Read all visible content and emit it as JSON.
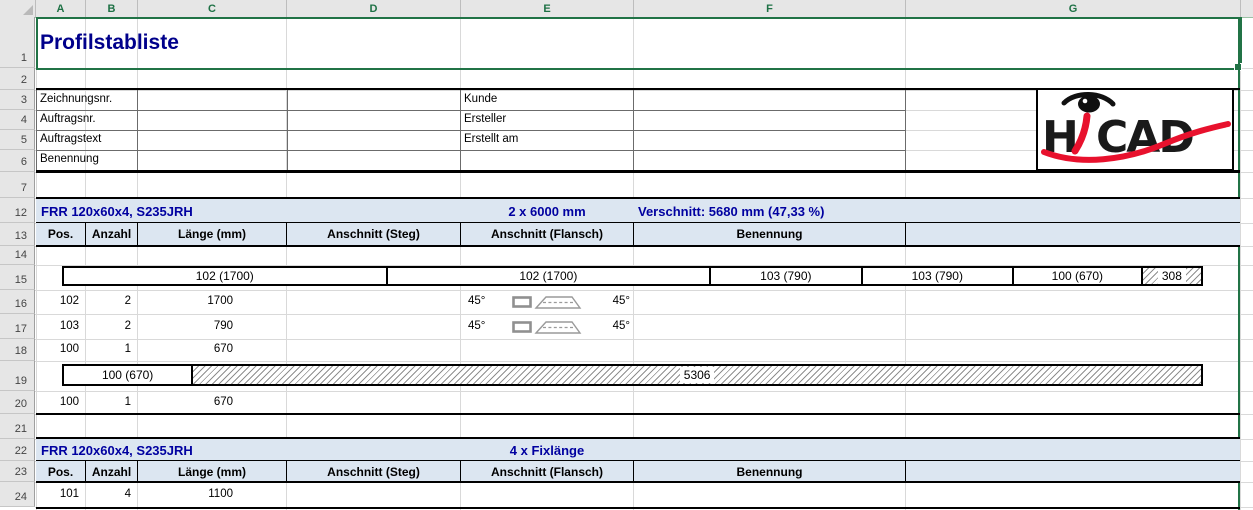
{
  "colors": {
    "accent_green": "#217346",
    "band_blue_bg": "#dce6f1",
    "navy_text": "#0000A0",
    "logo_red": "#E8112D"
  },
  "sheet": {
    "columns": [
      {
        "label": "A"
      },
      {
        "label": "B"
      },
      {
        "label": "C"
      },
      {
        "label": "D"
      },
      {
        "label": "E"
      },
      {
        "label": "F"
      },
      {
        "label": "G"
      }
    ],
    "rows": [
      {
        "n": "1"
      },
      {
        "n": "2"
      },
      {
        "n": "3"
      },
      {
        "n": "4"
      },
      {
        "n": "5"
      },
      {
        "n": "6"
      },
      {
        "n": "7"
      },
      {
        "n": "12"
      },
      {
        "n": "13"
      },
      {
        "n": "14"
      },
      {
        "n": "15"
      },
      {
        "n": "16"
      },
      {
        "n": "17"
      },
      {
        "n": "18"
      },
      {
        "n": "19"
      },
      {
        "n": "20"
      },
      {
        "n": "21"
      },
      {
        "n": "22"
      },
      {
        "n": "23"
      },
      {
        "n": "24"
      }
    ]
  },
  "title": {
    "text": "Profilstabliste"
  },
  "info": {
    "left_labels": [
      {
        "label": "Zeichnungsnr."
      },
      {
        "label": "Auftragsnr."
      },
      {
        "label": "Auftragstext"
      },
      {
        "label": "Benennung"
      }
    ],
    "right_labels": [
      {
        "label": "Kunde"
      },
      {
        "label": "Ersteller"
      },
      {
        "label": "Erstellt am"
      }
    ]
  },
  "logo": {
    "h": "H",
    "i": "i",
    "cad": "CAD"
  },
  "table_headers": {
    "pos": "Pos.",
    "anzahl": "Anzahl",
    "laenge": "Länge (mm)",
    "steg": "Anschnitt (Steg)",
    "flansch": "Anschnitt (Flansch)",
    "benennung": "Benennung"
  },
  "sections": [
    {
      "profile": "FRR 120x60x4, S235JRH",
      "stock": "2 x 6000 mm",
      "waste_note": "Verschnitt: 5680 mm (47,33 %)",
      "bar1": {
        "segments": [
          {
            "label": "102 (1700)",
            "mm": 1700
          },
          {
            "label": "102 (1700)",
            "mm": 1700
          },
          {
            "label": "103 (790)",
            "mm": 790
          },
          {
            "label": "103 (790)",
            "mm": 790
          },
          {
            "label": "100 (670)",
            "mm": 670
          }
        ],
        "rest": {
          "label": "308",
          "mm": 308
        }
      },
      "rows": [
        {
          "pos": "102",
          "anzahl": "2",
          "laenge": "1700",
          "angle_left": "45°",
          "angle_right": "45°"
        },
        {
          "pos": "103",
          "anzahl": "2",
          "laenge": "790",
          "angle_left": "45°",
          "angle_right": "45°"
        },
        {
          "pos": "100",
          "anzahl": "1",
          "laenge": "670"
        }
      ],
      "bar2": {
        "segments": [
          {
            "label": "100 (670)",
            "mm": 670
          }
        ],
        "rest": {
          "label": "5306",
          "mm": 5306
        }
      },
      "rows2": [
        {
          "pos": "100",
          "anzahl": "1",
          "laenge": "670"
        }
      ]
    },
    {
      "profile": "FRR 120x60x4, S235JRH",
      "stock": "4 x Fixlänge",
      "rows": [
        {
          "pos": "101",
          "anzahl": "4",
          "laenge": "1100"
        }
      ]
    }
  ]
}
